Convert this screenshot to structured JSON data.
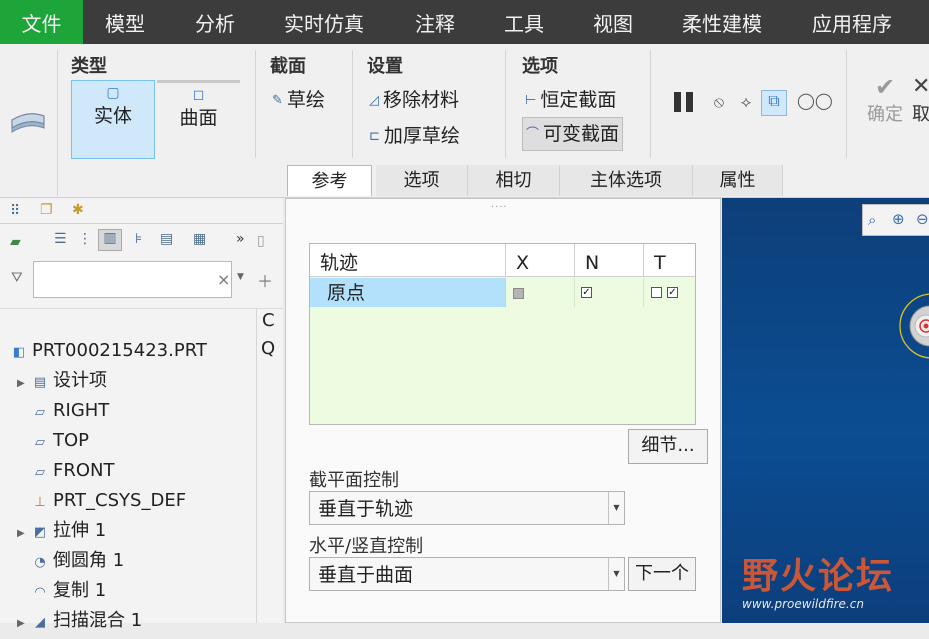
{
  "menu": [
    "文件",
    "模型",
    "分析",
    "实时仿真",
    "注释",
    "工具",
    "视图",
    "柔性建模",
    "应用程序"
  ],
  "ribbon": {
    "type_group": {
      "title": "类型",
      "solid": "实体",
      "surface": "曲面"
    },
    "section_group": {
      "title": "截面",
      "sketch": "草绘"
    },
    "settings_group": {
      "title": "设置",
      "remove_material": "移除材料",
      "thicken_sketch": "加厚草绘"
    },
    "options_group": {
      "title": "选项",
      "constant_section": "恒定截面",
      "variable_section": "可变截面"
    },
    "confirm": "确定",
    "cancel": "取"
  },
  "tabs": [
    "参考",
    "选项",
    "相切",
    "主体选项",
    "属性"
  ],
  "left_panel": {
    "filter_clear": "×",
    "col_header": "C",
    "col_header2": "Q",
    "tree": [
      {
        "label": "PRT000215423.PRT",
        "icon": "part-icon",
        "expandable": false
      },
      {
        "label": "设计项",
        "icon": "design-items-icon",
        "expandable": true
      },
      {
        "label": "RIGHT",
        "icon": "datum-plane-icon",
        "expandable": false
      },
      {
        "label": "TOP",
        "icon": "datum-plane-icon",
        "expandable": false
      },
      {
        "label": "FRONT",
        "icon": "datum-plane-icon",
        "expandable": false
      },
      {
        "label": "PRT_CSYS_DEF",
        "icon": "csys-icon",
        "expandable": false
      },
      {
        "label": "拉伸 1",
        "icon": "extrude-icon",
        "expandable": true
      },
      {
        "label": "倒圆角 1",
        "icon": "round-icon",
        "expandable": false
      },
      {
        "label": "复制 1",
        "icon": "copy-icon",
        "expandable": false
      },
      {
        "label": "扫描混合 1",
        "icon": "sweep-blend-icon",
        "expandable": true
      }
    ]
  },
  "panel": {
    "grip": "....",
    "table": {
      "headers": [
        "轨迹",
        "X",
        "N",
        "T"
      ],
      "rows": [
        {
          "name": "原点",
          "x": "gray",
          "n": true,
          "t_left": false,
          "t_right": true
        }
      ]
    },
    "details_button": "细节...",
    "section_plane_label": "截平面控制",
    "section_plane_value": "垂直于轨迹",
    "hv_label": "水平/竖直控制",
    "hv_value": "垂直于曲面",
    "next_button": "下一个"
  },
  "watermark": {
    "title": "野火论坛",
    "url": "www.proewildfire.cn"
  },
  "colors": {
    "menu_bg": "#3c3c3c",
    "file_tab": "#1ea53a",
    "grid_bg": "#edfbe0",
    "row_sel": "#b3e0fb",
    "gfx_bg": "#0b4d92"
  }
}
